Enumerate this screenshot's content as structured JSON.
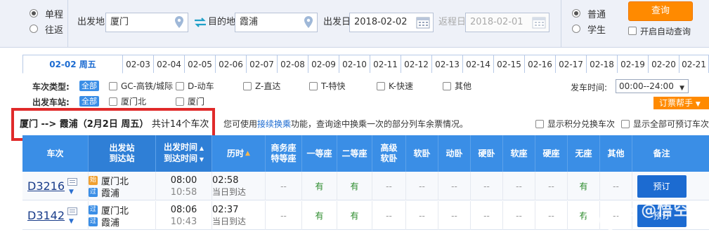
{
  "search": {
    "trip_types": [
      {
        "label": "单程",
        "selected": true
      },
      {
        "label": "往返",
        "selected": false
      }
    ],
    "from_label": "出发地",
    "from_value": "厦门",
    "to_label": "目的地",
    "to_value": "霞浦",
    "depart_label": "出发日",
    "depart_value": "2018-02-02",
    "return_label": "返程日",
    "return_value": "2018-02-01",
    "passenger_types": [
      {
        "label": "普通",
        "selected": true
      },
      {
        "label": "学生",
        "selected": false
      }
    ],
    "query_label": "查询",
    "auto_query_label": "开启自动查询"
  },
  "date_tabs": [
    {
      "label": "02-02  周五",
      "active": true
    },
    {
      "label": "02-03"
    },
    {
      "label": "02-04"
    },
    {
      "label": "02-05"
    },
    {
      "label": "02-06"
    },
    {
      "label": "02-07"
    },
    {
      "label": "02-08"
    },
    {
      "label": "02-09"
    },
    {
      "label": "02-10"
    },
    {
      "label": "02-11"
    },
    {
      "label": "02-12"
    },
    {
      "label": "02-13"
    },
    {
      "label": "02-14"
    },
    {
      "label": "02-15"
    },
    {
      "label": "02-16"
    },
    {
      "label": "02-17"
    },
    {
      "label": "02-18"
    },
    {
      "label": "02-19"
    },
    {
      "label": "02-20"
    },
    {
      "label": "02-21"
    }
  ],
  "filters": {
    "train_type_label": "车次类型:",
    "all_label": "全部",
    "train_types": [
      "GC-高铁/城际",
      "D-动车",
      "Z-直达",
      "T-特快",
      "K-快速",
      "其他"
    ],
    "station_label": "出发车站:",
    "stations": [
      "厦门北",
      "厦门"
    ],
    "dep_time_label": "发车时间:",
    "dep_time_value": "00:00--24:00",
    "help_label": "订票帮手"
  },
  "summary": {
    "route": "厦门 --> 霞浦（2月2日  周五）",
    "count": "共计14个车次",
    "hint_before": "您可使用",
    "hint_link": "接续换乘",
    "hint_after": "功能，查询途中换乘一次的部分列车余票情况。",
    "opt_points": "显示积分兑换车次",
    "opt_all": "显示全部可预订车次"
  },
  "table": {
    "headers": {
      "train": "车次",
      "station_1": "出发站",
      "station_2": "到达站",
      "time_1": "出发时间",
      "time_2": "到达时间",
      "duration": "历时",
      "business_1": "商务座",
      "business_2": "特等座",
      "first": "一等座",
      "second": "二等座",
      "sleeper_hi_1": "高级",
      "sleeper_hi_2": "软卧",
      "soft_sleeper": "软卧",
      "moving_sleeper": "动卧",
      "hard_sleeper": "硬卧",
      "soft_seat": "软座",
      "hard_seat": "硬座",
      "no_seat": "无座",
      "other": "其他",
      "remark": "备注"
    },
    "rows": [
      {
        "train": "D3216",
        "from_badge": "始",
        "from": "厦门北",
        "to_badge": "过",
        "to": "霞浦",
        "dep": "08:00",
        "arr": "10:58",
        "duration": "02:58",
        "duration_note": "当日到达",
        "cells": [
          "--",
          "有",
          "有",
          "--",
          "--",
          "--",
          "--",
          "--",
          "--",
          "有",
          "--"
        ],
        "book": "预订"
      },
      {
        "train": "D3142",
        "from_badge": "过",
        "from": "厦门北",
        "to_badge": "过",
        "to": "霞浦",
        "dep": "08:06",
        "arr": "10:43",
        "duration": "02:37",
        "duration_note": "当日到达",
        "cells": [
          "--",
          "有",
          "有",
          "--",
          "--",
          "--",
          "--",
          "--",
          "--",
          "有",
          "--"
        ],
        "book": "预订"
      }
    ]
  },
  "watermark": "头条 @悟空问答",
  "colors": {
    "header_blue": "#3a8ee6",
    "accent_orange": "#ff8a00",
    "highlight_red": "#e02a2a",
    "available_green": "#2a8a2a"
  }
}
